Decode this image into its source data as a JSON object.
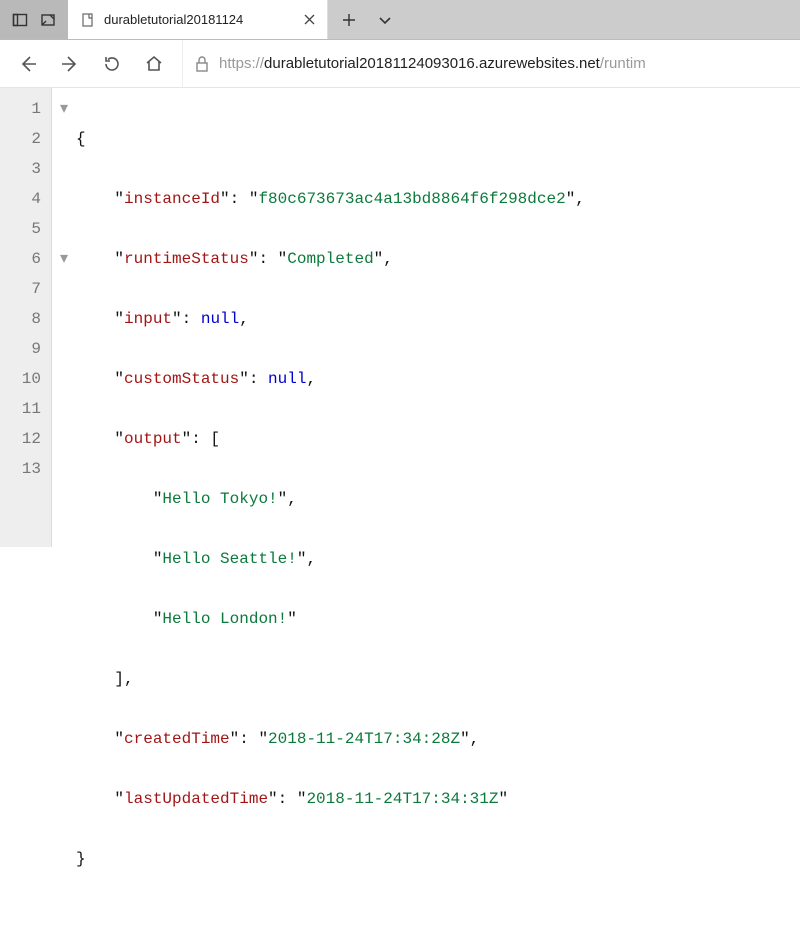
{
  "tab": {
    "title": "durabletutorial20181124"
  },
  "url": {
    "scheme": "https://",
    "host": "durabletutorial20181124093016.azurewebsites.net",
    "path": "/runtim"
  },
  "json": {
    "instanceId_key": "instanceId",
    "instanceId_val": "f80c673673ac4a13bd8864f6f298dce2",
    "runtimeStatus_key": "runtimeStatus",
    "runtimeStatus_val": "Completed",
    "input_key": "input",
    "input_val": "null",
    "customStatus_key": "customStatus",
    "customStatus_val": "null",
    "output_key": "output",
    "output_0": "Hello Tokyo!",
    "output_1": "Hello Seattle!",
    "output_2": "Hello London!",
    "createdTime_key": "createdTime",
    "createdTime_val": "2018-11-24T17:34:28Z",
    "lastUpdatedTime_key": "lastUpdatedTime",
    "lastUpdatedTime_val": "2018-11-24T17:34:31Z"
  },
  "lines": [
    "1",
    "2",
    "3",
    "4",
    "5",
    "6",
    "7",
    "8",
    "9",
    "10",
    "11",
    "12",
    "13"
  ]
}
